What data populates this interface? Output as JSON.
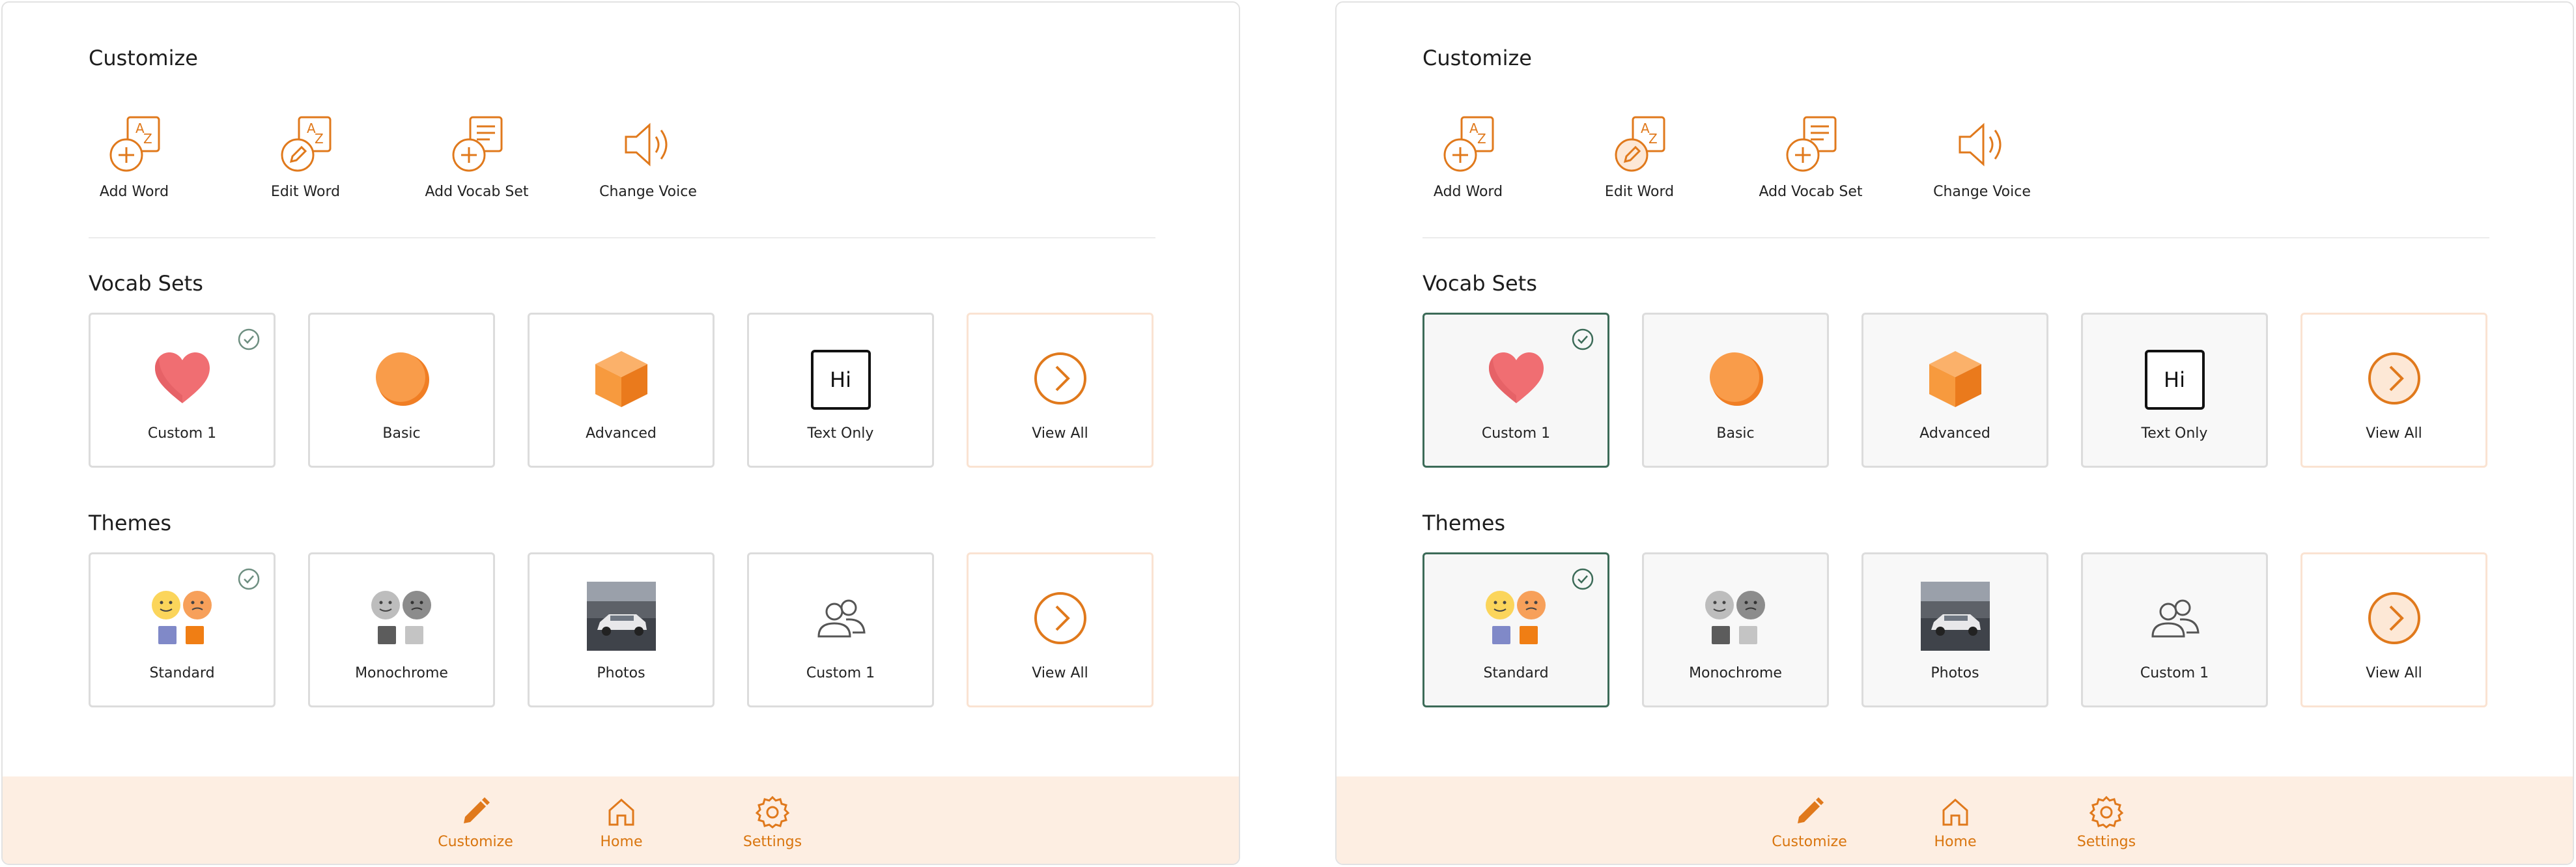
{
  "colors": {
    "accent": "#e0791c",
    "selected_border": "#3c6b58",
    "bottom_bar": "#fdeee2",
    "tile_border": "#dcdcdc"
  },
  "panels": [
    {
      "customize": {
        "title": "Customize",
        "actions": [
          {
            "label": "Add Word",
            "icon": "add-word-icon"
          },
          {
            "label": "Edit Word",
            "icon": "edit-word-icon"
          },
          {
            "label": "Add Vocab Set",
            "icon": "add-vocab-set-icon"
          },
          {
            "label": "Change Voice",
            "icon": "speaker-icon"
          }
        ]
      },
      "vocab_sets": {
        "title": "Vocab Sets",
        "tiles": [
          {
            "label": "Custom 1",
            "icon": "heart-icon",
            "checked": true
          },
          {
            "label": "Basic",
            "icon": "circle-icon",
            "checked": false
          },
          {
            "label": "Advanced",
            "icon": "cube-icon",
            "checked": false
          },
          {
            "label": "Text Only",
            "icon": "text-hi-icon",
            "icon_text": "Hi",
            "checked": false
          },
          {
            "label": "View All",
            "icon": "chevron-right-circle-icon",
            "checked": false
          }
        ]
      },
      "themes": {
        "title": "Themes",
        "tiles": [
          {
            "label": "Standard",
            "icon": "standard-theme-icon",
            "checked": true
          },
          {
            "label": "Monochrome",
            "icon": "monochrome-theme-icon",
            "checked": false
          },
          {
            "label": "Photos",
            "icon": "photo-icon",
            "checked": false
          },
          {
            "label": "Custom 1",
            "icon": "users-icon",
            "checked": false
          },
          {
            "label": "View All",
            "icon": "chevron-right-circle-icon",
            "checked": false
          }
        ]
      },
      "nav": [
        {
          "label": "Customize",
          "icon": "pencil-icon",
          "active": true
        },
        {
          "label": "Home",
          "icon": "home-icon",
          "active": false
        },
        {
          "label": "Settings",
          "icon": "gear-icon",
          "active": false
        }
      ]
    },
    {
      "customize": {
        "title": "Customize",
        "actions": [
          {
            "label": "Add Word",
            "icon": "add-word-icon"
          },
          {
            "label": "Edit Word",
            "icon": "edit-word-icon"
          },
          {
            "label": "Add Vocab Set",
            "icon": "add-vocab-set-icon"
          },
          {
            "label": "Change Voice",
            "icon": "speaker-icon"
          }
        ]
      },
      "vocab_sets": {
        "title": "Vocab Sets",
        "tiles": [
          {
            "label": "Custom 1",
            "icon": "heart-icon",
            "checked": true
          },
          {
            "label": "Basic",
            "icon": "circle-icon",
            "checked": false
          },
          {
            "label": "Advanced",
            "icon": "cube-icon",
            "checked": false
          },
          {
            "label": "Text Only",
            "icon": "text-hi-icon",
            "icon_text": "Hi",
            "checked": false
          },
          {
            "label": "View All",
            "icon": "chevron-right-circle-icon",
            "checked": false
          }
        ]
      },
      "themes": {
        "title": "Themes",
        "tiles": [
          {
            "label": "Standard",
            "icon": "standard-theme-icon",
            "checked": true
          },
          {
            "label": "Monochrome",
            "icon": "monochrome-theme-icon",
            "checked": false
          },
          {
            "label": "Photos",
            "icon": "photo-icon",
            "checked": false
          },
          {
            "label": "Custom 1",
            "icon": "users-icon",
            "checked": false
          },
          {
            "label": "View All",
            "icon": "chevron-right-circle-icon",
            "checked": false
          }
        ]
      },
      "nav": [
        {
          "label": "Customize",
          "icon": "pencil-icon",
          "active": true
        },
        {
          "label": "Home",
          "icon": "home-icon",
          "active": false
        },
        {
          "label": "Settings",
          "icon": "gear-icon",
          "active": false
        }
      ]
    }
  ]
}
